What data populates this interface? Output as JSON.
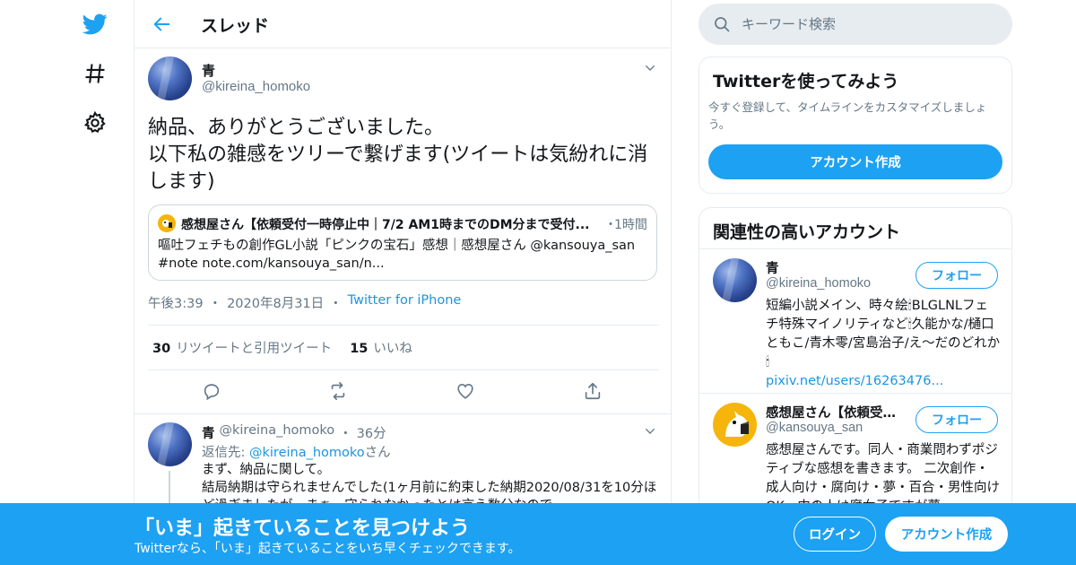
{
  "nav": {
    "logo_icon": "twitter-bird-icon",
    "explore_icon": "hashtag-icon",
    "settings_icon": "gear-icon"
  },
  "header": {
    "title": "スレッド",
    "back_icon": "arrow-left-icon"
  },
  "tweet": {
    "name": "青",
    "handle": "@kireina_homoko",
    "text": "納品、ありがとうございました。\n以下私の雑感をツリーで繋げます(ツイートは気紛れに消します)",
    "quote": {
      "name": "感想屋さん【依頼受付一時停止中｜7/2 AM1時までのDM分まで受付...",
      "dot": "・",
      "time": "1時間",
      "text": "嘔吐フェチもの創作GL小説「ピンクの宝石」感想｜感想屋さん @kansouya_san #note note.com/kansouya_san/n..."
    },
    "time": "午後3:39",
    "sep1": "・",
    "date": "2020年8月31日",
    "sep2": "・",
    "source": "Twitter for iPhone",
    "retweets_count": "30",
    "retweets_label": "リツイートと引用ツイート",
    "likes_count": "15",
    "likes_label": "いいね"
  },
  "reply": {
    "name": "青",
    "handle": "@kireina_homoko",
    "dot": "・",
    "time": "36分",
    "reply_prefix": "返信先: ",
    "reply_to": "@kireina_homoko",
    "reply_suffix": "さん",
    "text": "まず、納品に関して。\n結局納期は守られませんでした(1ヶ月前に約束した納期2020/08/31を10分ほど過ぎましたが…まぁ、守られなかったとは言え数分なので"
  },
  "search": {
    "placeholder": "キーワード検索"
  },
  "signup_card": {
    "title": "Twitterを使ってみよう",
    "subtitle": "今すぐ登録して、タイムラインをカスタマイズしましょう。",
    "button": "アカウント作成"
  },
  "related": {
    "title": "関連性の高いアカウント",
    "accounts": [
      {
        "name": "青",
        "handle": "@kireina_homoko",
        "follow": "フォロー",
        "bio": "短編小説メイン、時々絵🕯BLGLNLフェチ特殊マイノリティなど🕯久能かな/樋口ともこ/青木零/宮島治子/え〜だのどれか🕯",
        "link": "pixiv.net/users/16263476..."
      },
      {
        "name": "感想屋さん【依頼受付一時停止中】",
        "handle": "@kansouya_san",
        "follow": "フォロー",
        "bio": "感想屋さんです。同人・商業問わずポジティブな感想を書きます。 二次創作・成人向け・腐向け・夢・百合・男性向けOK。中の人は腐女子ですが夢"
      }
    ]
  },
  "banner": {
    "title": "「いま」起きていることを見つけよう",
    "subtitle": "Twitterなら、「いま」起きていることをいち早くチェックできます。",
    "login": "ログイン",
    "signup": "アカウント作成"
  },
  "colors": {
    "accent": "#1da1f2",
    "link": "#1b95e0",
    "muted": "#657786",
    "border": "#e6ecf0"
  }
}
